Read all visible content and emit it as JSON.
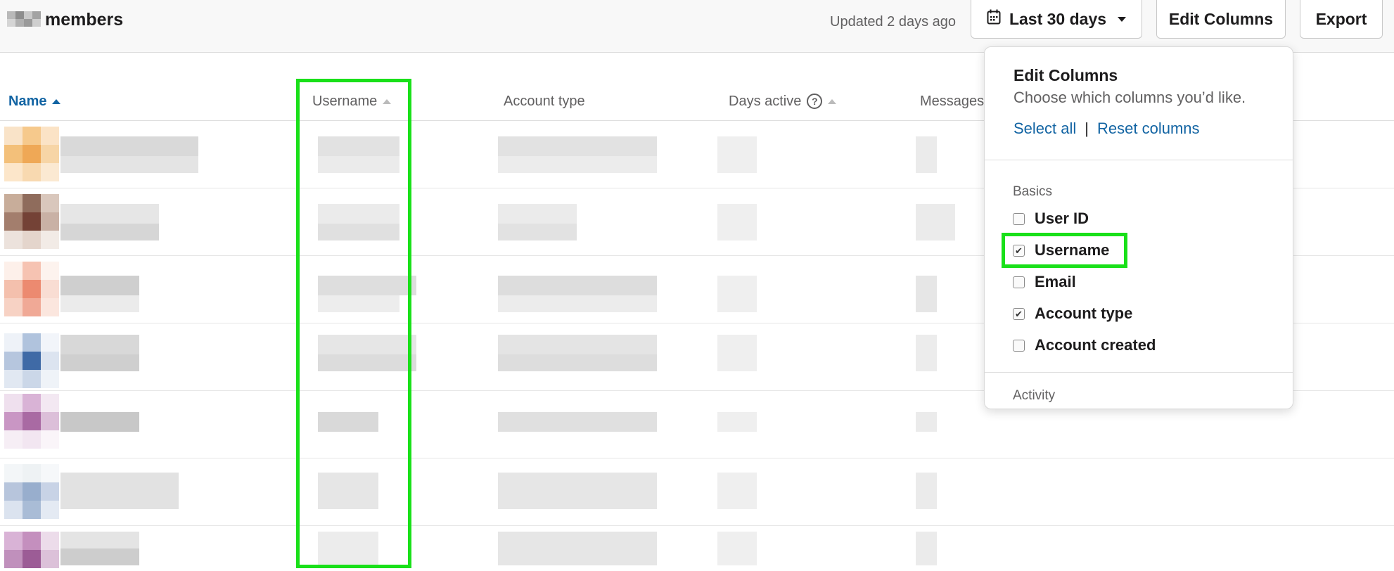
{
  "header": {
    "title": "members",
    "updated_text": "Updated 2 days ago",
    "date_range_label": "Last 30 days",
    "edit_columns_label": "Edit Columns",
    "export_label": "Export"
  },
  "table": {
    "columns": [
      {
        "label": "Name",
        "sorted": "asc",
        "active": true
      },
      {
        "label": "Username",
        "sorted": "none",
        "active": false
      },
      {
        "label": "Account type",
        "active": false
      },
      {
        "label": "Days active",
        "has_help": true,
        "sorted": "none",
        "active": false
      },
      {
        "label": "Messages",
        "active": false
      }
    ],
    "help_glyph": "?"
  },
  "edit_columns_popover": {
    "title": "Edit Columns",
    "subtitle": "Choose which columns you’d like.",
    "select_all": "Select all",
    "separator": "|",
    "reset": "Reset columns",
    "sections": [
      {
        "name": "Basics",
        "options": [
          {
            "label": "User ID",
            "checked": false
          },
          {
            "label": "Username",
            "checked": true
          },
          {
            "label": "Email",
            "checked": false
          },
          {
            "label": "Account type",
            "checked": true
          },
          {
            "label": "Account created",
            "checked": false
          }
        ]
      },
      {
        "name": "Activity",
        "options": []
      }
    ]
  },
  "colors": {
    "highlight": "#19e019",
    "link": "#1264a3",
    "text": "#1d1c1d",
    "muted": "#616061"
  },
  "icons": {
    "date_range": "calendar-icon",
    "dropdown": "chevron-down-icon",
    "sort": "sort-ascending-icon",
    "help": "help-circle-icon"
  }
}
